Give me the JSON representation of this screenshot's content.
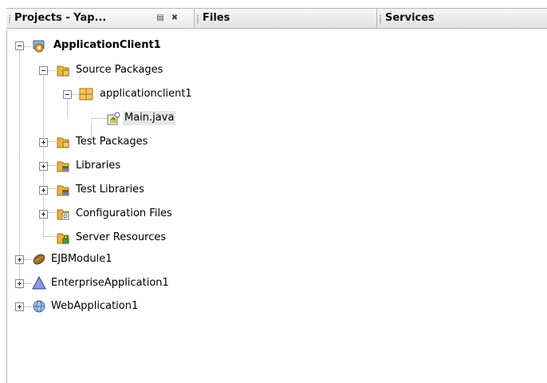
{
  "tabs": [
    {
      "label": "Projects - Yap..."
    },
    {
      "label": "Files"
    },
    {
      "label": "Services"
    }
  ],
  "tree": {
    "root": "ApplicationClient1",
    "source_packages": "Source Packages",
    "package": "applicationclient1",
    "main_file": "Main.java",
    "test_packages": "Test Packages",
    "libraries": "Libraries",
    "test_libraries": "Test Libraries",
    "configuration_files": "Configuration Files",
    "server_resources": "Server Resources",
    "ejb_module": "EJBModule1",
    "enterprise_app": "EnterpriseApplication1",
    "web_app": "WebApplication1"
  },
  "colors": {
    "folder": "#e7b33a",
    "package": "#e6a63b",
    "ejb": "#9b6a2a",
    "enterprise": "#5667b8",
    "web": "#6e9bd0"
  }
}
